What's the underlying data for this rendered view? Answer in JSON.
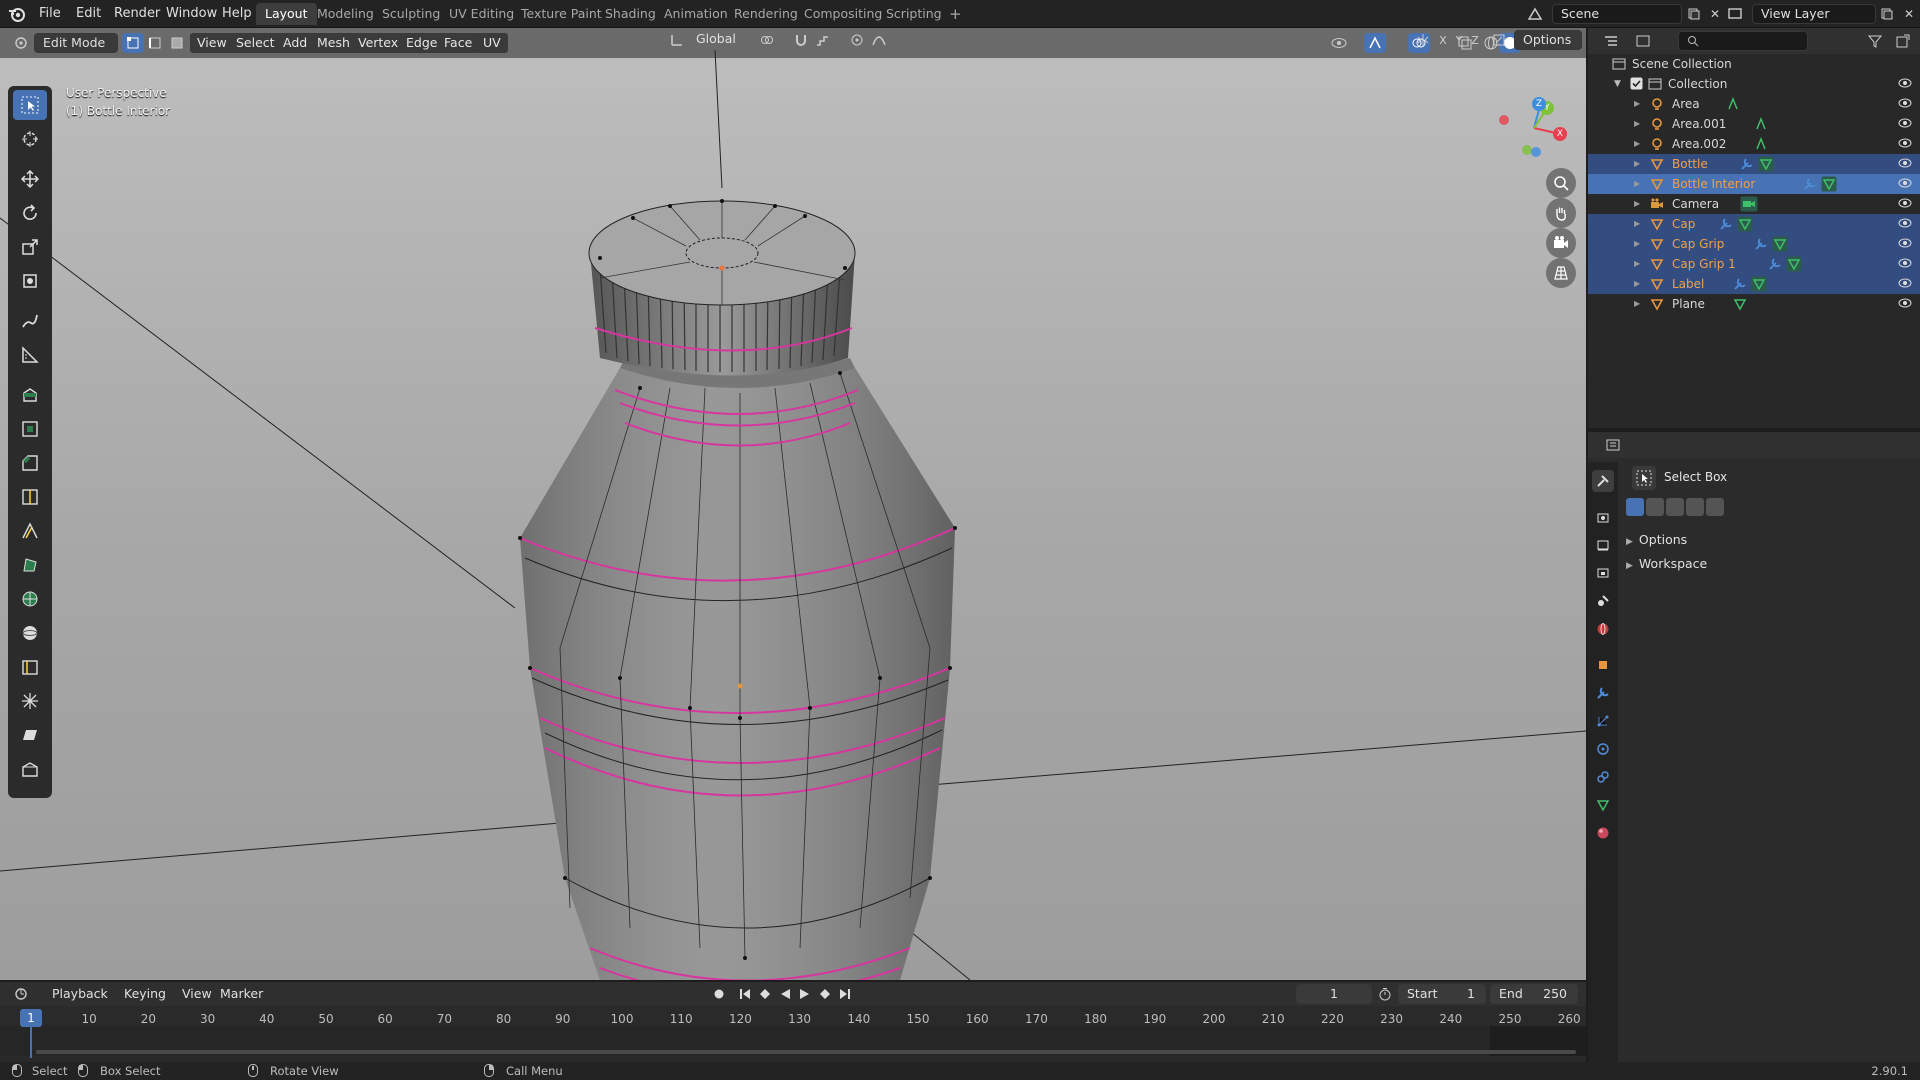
{
  "topbar": {
    "menus": [
      "File",
      "Edit",
      "Render",
      "Window",
      "Help"
    ],
    "workspaces": [
      "Layout",
      "Modeling",
      "Sculpting",
      "UV Editing",
      "Texture Paint",
      "Shading",
      "Animation",
      "Rendering",
      "Compositing",
      "Scripting"
    ],
    "active_workspace": "Layout",
    "add_workspace": "+",
    "scene": "Scene",
    "view_layer": "View Layer"
  },
  "header2": {
    "orientation": "Global",
    "axis_x": "X",
    "axis_y": "Y",
    "axis_z": "Z",
    "options": "Options"
  },
  "viewport_header": {
    "mode": "Edit Mode",
    "menus": [
      "View",
      "Select",
      "Add",
      "Mesh",
      "Vertex",
      "Edge",
      "Face",
      "UV"
    ]
  },
  "viewport": {
    "perspective": "User Perspective",
    "object": "(1) Bottle Interior"
  },
  "gizmo": {
    "x": "X",
    "y": "Y",
    "z": "Z",
    "color_x": "#e8404e",
    "color_y": "#7ec23a",
    "color_z": "#3d8de0"
  },
  "outliner": {
    "root": "Scene Collection",
    "collection": "Collection",
    "items": [
      {
        "name": "Area",
        "kind": "light",
        "state": "normal"
      },
      {
        "name": "Area.001",
        "kind": "light",
        "state": "normal"
      },
      {
        "name": "Area.002",
        "kind": "light",
        "state": "normal"
      },
      {
        "name": "Bottle",
        "kind": "mesh",
        "state": "selected"
      },
      {
        "name": "Bottle Interior",
        "kind": "mesh",
        "state": "active"
      },
      {
        "name": "Camera",
        "kind": "camera",
        "state": "normal"
      },
      {
        "name": "Cap",
        "kind": "mesh",
        "state": "selected"
      },
      {
        "name": "Cap Grip",
        "kind": "mesh",
        "state": "selected"
      },
      {
        "name": "Cap Grip 1",
        "kind": "mesh",
        "state": "selected"
      },
      {
        "name": "Label",
        "kind": "mesh",
        "state": "selected"
      },
      {
        "name": "Plane",
        "kind": "mesh",
        "state": "normal"
      }
    ]
  },
  "properties": {
    "tool_name": "Select Box",
    "sections": [
      "Options",
      "Workspace"
    ]
  },
  "timeline": {
    "menus": [
      "Playback",
      "Keying",
      "View",
      "Marker"
    ],
    "current_frame": "1",
    "start_label": "Start",
    "start": "1",
    "end_label": "End",
    "end": "250",
    "ticks": [
      "1",
      "10",
      "20",
      "30",
      "40",
      "50",
      "60",
      "70",
      "80",
      "90",
      "100",
      "110",
      "120",
      "130",
      "140",
      "150",
      "160",
      "170",
      "180",
      "190",
      "200",
      "210",
      "220",
      "230",
      "240",
      "250",
      "260"
    ]
  },
  "statusbar": {
    "select": "Select",
    "box_select": "Box Select",
    "rotate": "Rotate View",
    "call_menu": "Call Menu",
    "version": "2.90.1"
  },
  "colors": {
    "accent": "#4772b3",
    "selected_row": "#334d80",
    "object_orange": "#e8963c",
    "edge_pink": "#d7359f"
  }
}
